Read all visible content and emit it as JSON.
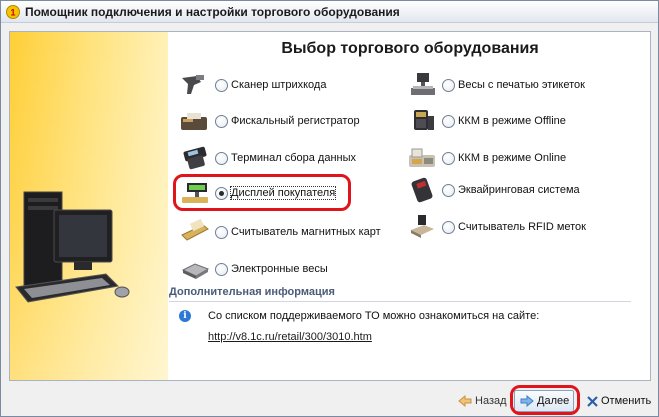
{
  "window": {
    "title": "Помощник подключения и настройки торгового оборудования"
  },
  "page": {
    "title": "Выбор торгового оборудования"
  },
  "devices_left": [
    {
      "label": "Сканер штрихкода",
      "icon": "barcode-scanner-icon",
      "selected": false
    },
    {
      "label": "Фискальный регистратор",
      "icon": "fiscal-printer-icon",
      "selected": false
    },
    {
      "label": "Терминал сбора данных",
      "icon": "data-terminal-icon",
      "selected": false
    },
    {
      "label": "Дисплей покупателя",
      "icon": "customer-display-icon",
      "selected": true
    },
    {
      "label": "Считыватель магнитных карт",
      "icon": "card-reader-icon",
      "selected": false
    },
    {
      "label": "Электронные весы",
      "icon": "scales-icon",
      "selected": false
    }
  ],
  "devices_right": [
    {
      "label": "Весы с печатью этикеток",
      "icon": "label-scales-icon",
      "selected": false
    },
    {
      "label": "ККМ в режиме Offline",
      "icon": "cash-register-offline-icon",
      "selected": false
    },
    {
      "label": "ККМ в режиме Online",
      "icon": "cash-register-online-icon",
      "selected": false
    },
    {
      "label": "Эквайринговая система",
      "icon": "pos-terminal-icon",
      "selected": false
    },
    {
      "label": "Считыватель RFID меток",
      "icon": "rfid-reader-icon",
      "selected": false
    }
  ],
  "info": {
    "header": "Дополнительная информация",
    "text": "Со списком поддерживаемого ТО можно ознакомиться на сайте:",
    "link": "http://v8.1c.ru/retail/300/3010.htm"
  },
  "buttons": {
    "back": "Назад",
    "next": "Далее",
    "cancel": "Отменить"
  },
  "colors": {
    "highlight": "#e0141b",
    "panel": "#ffd84a",
    "info_header": "#4a5b78"
  }
}
